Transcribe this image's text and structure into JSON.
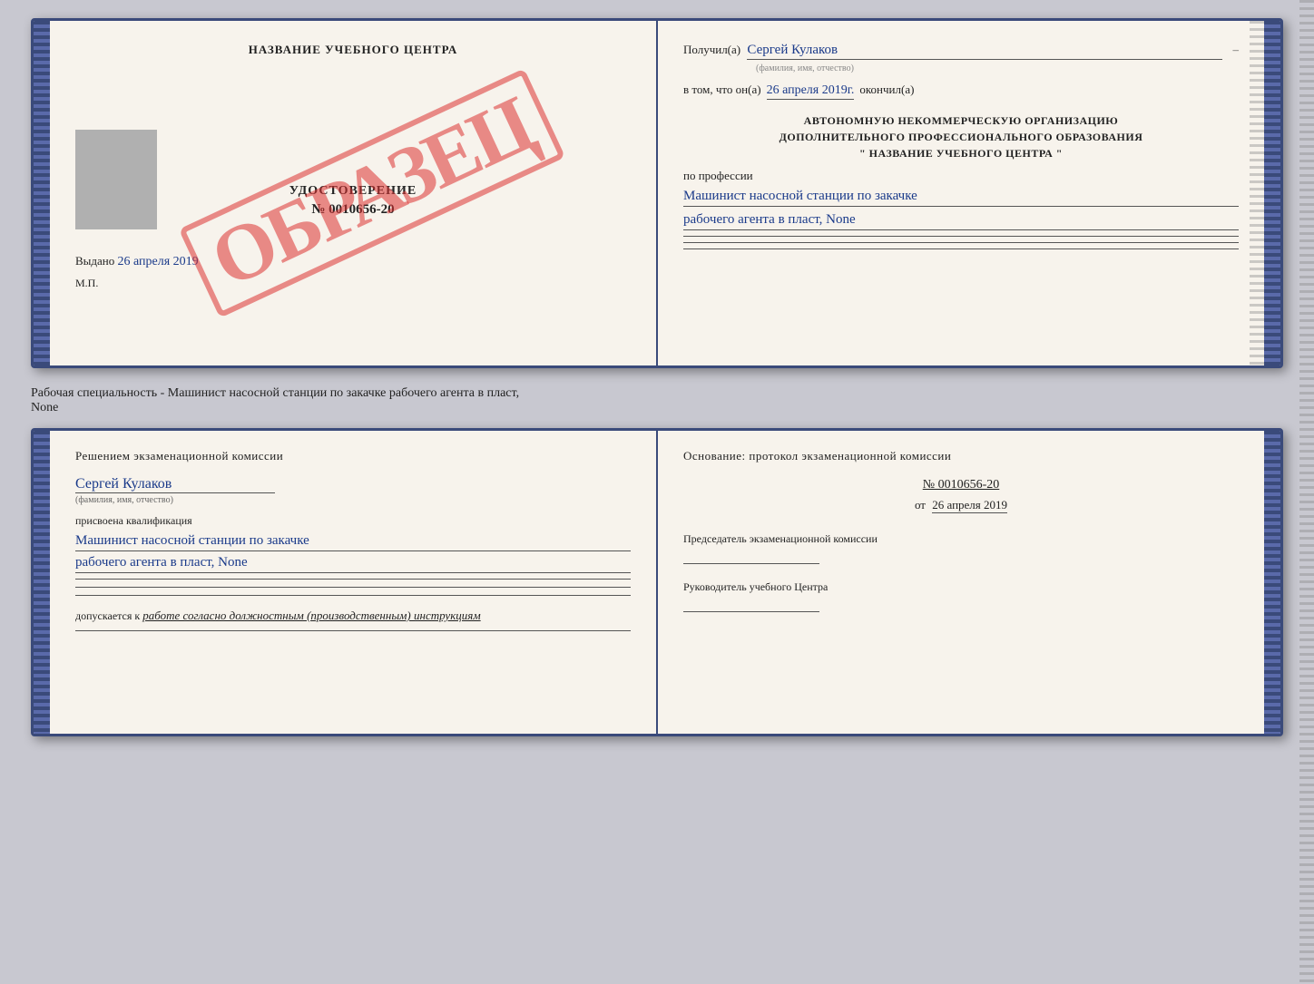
{
  "top_document": {
    "left_page": {
      "title": "НАЗВАНИЕ УЧЕБНОГО ЦЕНТРА",
      "stamp_text": "ОБРАЗЕЦ",
      "udostoverenie_label": "УДОСТОВЕРЕНИЕ",
      "number": "№ 0010656-20",
      "vydano_label": "Выдано",
      "vydano_date": "26 апреля 2019",
      "mp_label": "М.П."
    },
    "right_page": {
      "poluchil_label": "Получил(а)",
      "poluchil_name": "Сергей Кулаков",
      "familiya_label": "(фамилия, имя, отчество)",
      "vtom_label": "в том, что он(а)",
      "vtom_date": "26 апреля 2019г.",
      "okonchil_label": "окончил(а)",
      "block_title_line1": "АВТОНОМНУЮ НЕКОММЕРЧЕСКУЮ ОРГАНИЗАЦИЮ",
      "block_title_line2": "ДОПОЛНИТЕЛЬНОГО ПРОФЕССИОНАЛЬНОГО ОБРАЗОВАНИЯ",
      "block_title_line3": "\"  НАЗВАНИЕ УЧЕБНОГО ЦЕНТРА  \"",
      "po_professii_label": "по профессии",
      "profession_line1": "Машинист насосной станции по закачке",
      "profession_line2": "рабочего агента в пласт, None"
    }
  },
  "between_text": {
    "line1": "Рабочая специальность - Машинист насосной станции по закачке рабочего агента в пласт,",
    "line2": "None"
  },
  "bottom_document": {
    "left_page": {
      "resheniem_label": "Решением экзаменационной комиссии",
      "name": "Сергей Кулаков",
      "familiya_label": "(фамилия, имя, отчество)",
      "prisvoena_label": "присвоена квалификация",
      "profession_line1": "Машинист насосной станции по закачке",
      "profession_line2": "рабочего агента в пласт, None",
      "dopusk_label": "допускается к",
      "dopusk_value": "работе согласно должностным (производственным) инструкциям"
    },
    "right_page": {
      "osnovanie_label": "Основание: протокол экзаменационной комиссии",
      "number": "№ 0010656-20",
      "ot_label": "от",
      "ot_date": "26 апреля 2019",
      "predsedatel_label": "Председатель экзаменационной комиссии",
      "rukovoditel_label": "Руководитель учебного Центра"
    }
  }
}
